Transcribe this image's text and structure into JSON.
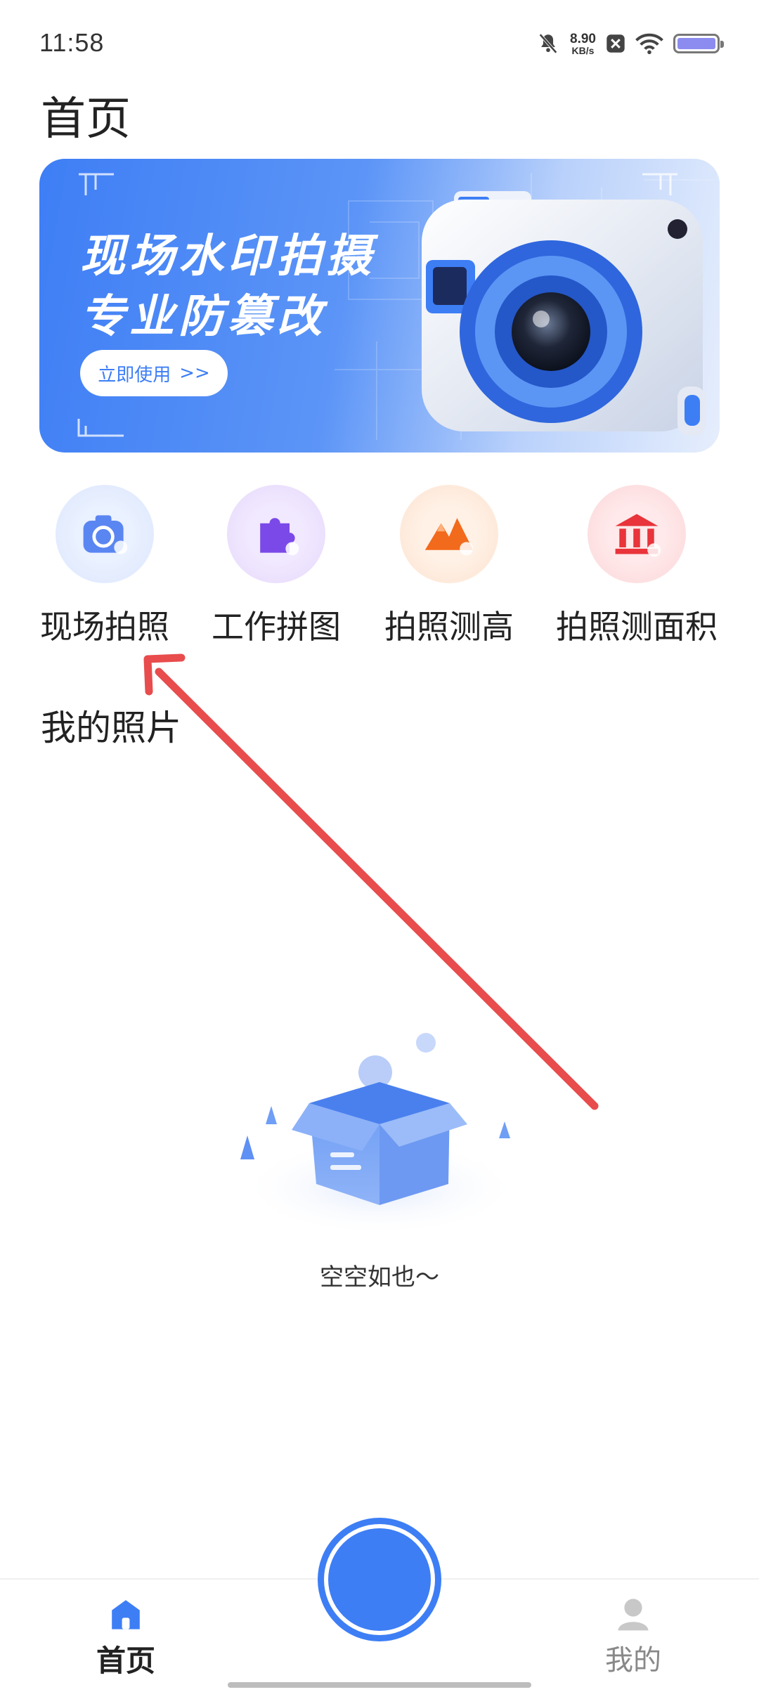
{
  "status_bar": {
    "time": "11:58",
    "net_speed_value": "8.90",
    "net_speed_unit": "KB/s",
    "icons": [
      "mute-icon",
      "network-x-icon",
      "wifi-icon",
      "battery-icon"
    ]
  },
  "page": {
    "title": "首页"
  },
  "banner": {
    "title_line1": "现场水印拍摄",
    "title_line2": "专业防篡改",
    "button_label": "立即使用",
    "button_arrow": ">>"
  },
  "features": [
    {
      "label": "现场拍照",
      "icon": "camera-icon",
      "color": "#4a7cf0"
    },
    {
      "label": "工作拼图",
      "icon": "puzzle-icon",
      "color": "#7b49e8"
    },
    {
      "label": "拍照测高",
      "icon": "mountain-icon",
      "color": "#f26a1b"
    },
    {
      "label": "拍照测面积",
      "icon": "building-icon",
      "color": "#e8343a"
    }
  ],
  "section": {
    "title": "我的照片"
  },
  "empty_state": {
    "text": "空空如也～"
  },
  "bottom_nav": {
    "home_label": "首页",
    "mine_label": "我的",
    "accent": "#3d7ef5"
  }
}
